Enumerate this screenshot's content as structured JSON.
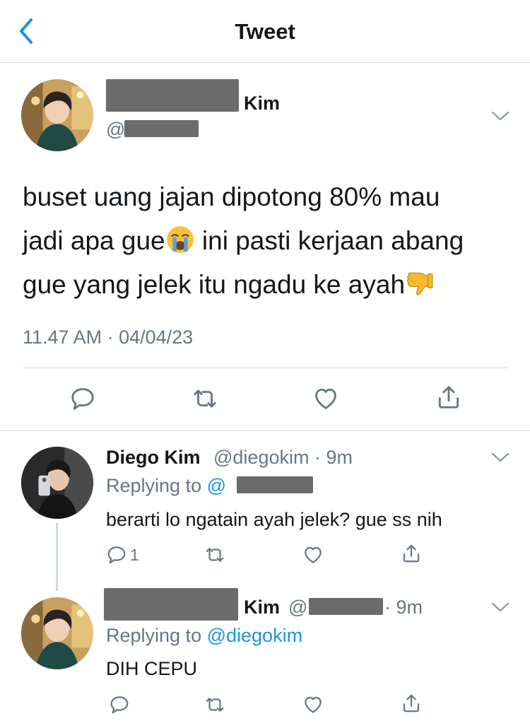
{
  "nav": {
    "title": "Tweet"
  },
  "main_tweet": {
    "name_suffix": "Kim",
    "handle_prefix": "@",
    "text_line1": "buset uang jajan dipotong 80% mau",
    "text_line2a": "jadi apa gue",
    "text_line2b": " ini pasti kerjaan abang",
    "text_line3": "gue yang jelek itu ngadu ke ayah",
    "time": "11.47 AM",
    "date_sep": " · ",
    "date": "04/04/23"
  },
  "replies": [
    {
      "name": "Diego Kim",
      "handle": "@diegokim",
      "time": "· 9m",
      "replying_prefix": "Replying to ",
      "replying_at": "@",
      "text": "berarti lo ngatain ayah jelek? gue ss nih",
      "reply_count": "1"
    },
    {
      "name_suffix": "Kim",
      "handle_prefix": "@",
      "time": "· 9m",
      "replying_prefix": "Replying to ",
      "replying_at": "@diegokim",
      "text": "DIH CEPU"
    }
  ],
  "colors": {
    "accent": "#1b95e0",
    "secondary_text": "#657786",
    "icon": "#657786",
    "divider": "#d8dde1"
  },
  "icons": [
    "back-icon",
    "chevron-down-icon",
    "reply-icon",
    "retweet-icon",
    "like-icon",
    "share-icon",
    "loudly-crying-emoji",
    "thumbs-down-emoji"
  ]
}
